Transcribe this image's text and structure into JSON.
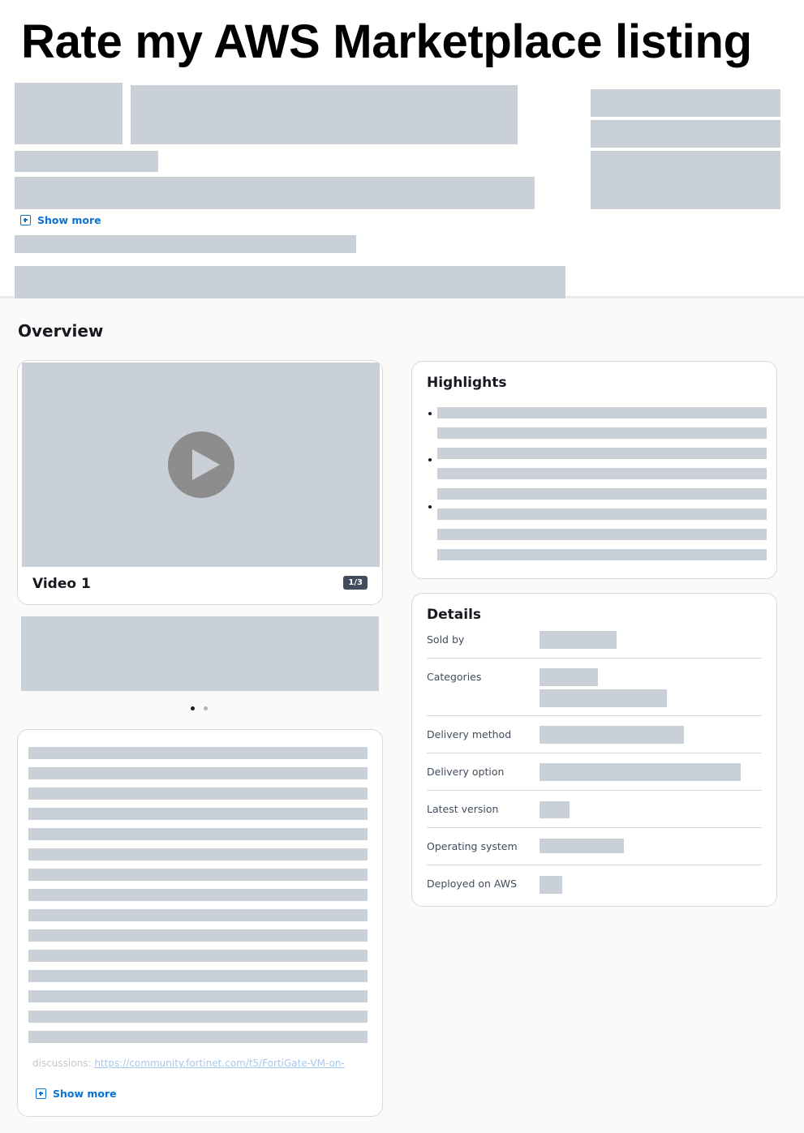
{
  "caption": {
    "text": "Rate my AWS Marketplace listing"
  },
  "header": {
    "show_more_label": "Show more"
  },
  "overview": {
    "title": "Overview",
    "video": {
      "title": "Video 1",
      "counter": "1/3"
    },
    "carousel": {
      "active_index": 1,
      "dot_count": 2
    },
    "description": {
      "visible_text": "discussions: ",
      "link_text": "https://community.fortinet.com/t5/FortiGate-VM-on-",
      "show_more_label": "Show more"
    },
    "highlights": {
      "title": "Highlights"
    },
    "details": {
      "title": "Details",
      "rows": [
        {
          "label": "Sold by"
        },
        {
          "label": "Categories"
        },
        {
          "label": "Delivery method"
        },
        {
          "label": "Delivery option"
        },
        {
          "label": "Latest version"
        },
        {
          "label": "Operating system"
        },
        {
          "label": "Deployed on AWS"
        }
      ]
    }
  },
  "colors": {
    "placeholder": "#c9d0d8",
    "link": "#0972d3",
    "counter_badge": "#414d5c",
    "play_button": "#8d8d8d"
  }
}
